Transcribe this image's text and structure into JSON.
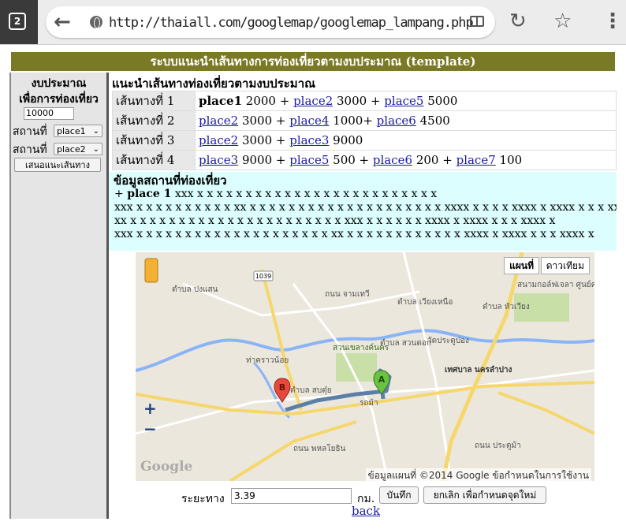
{
  "browser": {
    "tab_count": "2",
    "url": "http://thaiall.com/googlemap/googlemap_lampang.php",
    "icons": [
      "tab-switcher-icon",
      "back-arrow-icon",
      "globe-icon",
      "reader-mode-icon",
      "reload-icon",
      "star-icon",
      "more-vert-icon"
    ]
  },
  "page": {
    "title": "ระบบแนะนำเส้นทางการท่องเที่ยวตามงบประมาณ (template)",
    "title_bg": "#7a7a26"
  },
  "sidebar": {
    "title_line1": "งบประมาณ",
    "title_line2": "เพื่อการท่องเที่ยว",
    "budget_value": "10000",
    "place_label": "สถานที่",
    "place1_selected": "place1",
    "place2_selected": "place2",
    "suggest_button": "เสนอแนะเส้นทาง"
  },
  "main": {
    "heading": "แนะนำเส้นทางท่องเที่ยวตามงบประมาณ",
    "routes": [
      {
        "label": "เส้นทางที่ 1",
        "p1": "place1",
        "c1": " 2000 + ",
        "p2": "place2",
        "c2": " 3000 + ",
        "p3": "place5",
        "c3": " 5000",
        "p4": "",
        "c4": ""
      },
      {
        "label": "เส้นทางที่ 2",
        "p1": "place2",
        "c1": " 3000 + ",
        "p2": "place4",
        "c2": " 1000+ ",
        "p3": "place6",
        "c3": " 4500",
        "p4": "",
        "c4": ""
      },
      {
        "label": "เส้นทางที่ 3",
        "p1": "place2",
        "c1": " 3000 + ",
        "p2": "place3",
        "c2": " 9000",
        "p3": "",
        "c3": "",
        "p4": "",
        "c4": ""
      },
      {
        "label": "เส้นทางที่ 4",
        "p1": "place3",
        "c1": " 9000 + ",
        "p2": "place5",
        "c2": " 500 + ",
        "p3": "place6",
        "c3": " 200 + ",
        "p4": "place7",
        "c4": " 100"
      }
    ],
    "info_heading": "ข้อมูลสถานที่ท่องเที่ยว",
    "info_place_prefix": "+ ",
    "info_place_name": "place 1",
    "info_lines": [
      " xxx x x x x x x x x x x x x x x x x x x x x x x x x x",
      "xxx x x x x x x x x x x xx x x x x x x x x x x x x x x x x x x x x xxxx x x x x xxxx x xxxx x x x xxxx x",
      "xx x x x x x x x x x x x x x x x x x x x x x x xxx x x x x x x xxxx x xxxx x x x xxxx x",
      "xxx x x x x x x x x x x x x x x x x x x x x xx x x x x x x x x x x x x xxxx x xxxx x x x xxxx x"
    ]
  },
  "map": {
    "type_map": "แผนที่",
    "type_satellite": "ดาวเทียม",
    "zoom_in": "+",
    "zoom_out": "−",
    "google_logo": "Google",
    "credit": "ข้อมูลแผนที่ ©2014 Google   ข้อกำหนดในการใช้งาน",
    "marker_a": "A",
    "marker_b": "B",
    "road_label_1039": "1039",
    "labels": [
      "ตำบล ปงแสน",
      "ถนน จามเทวี",
      "ตำบล เวียงเหนือ",
      "วัดประตูป่อง",
      "ตำบล หัวเวียง",
      "สนามกอล์ฟเจลา ศูนย์ครกอล์ฟค่า",
      "สวนเขลางค์นคร",
      "ตำบล สวนดอก",
      "เทศบาล นครลำปาง",
      "ท่าคราวน้อย",
      "รถม้า",
      "ตำบล สบตุ๋ย",
      "ถนน พหลโยธิน",
      "ถนน ประตูม้า"
    ],
    "colors": {
      "route": "#5b7fa6",
      "river": "#8ab4f8",
      "major_road": "#f5d76e",
      "park": "#c8dfa8"
    }
  },
  "bottom": {
    "distance_label": "ระยะทาง",
    "distance_value": "3.39",
    "unit": "กม.",
    "save_button": "บันทึก",
    "cancel_button": "ยกเลิก เพื่อกำหนดจุดใหม่",
    "back_link": "back"
  }
}
